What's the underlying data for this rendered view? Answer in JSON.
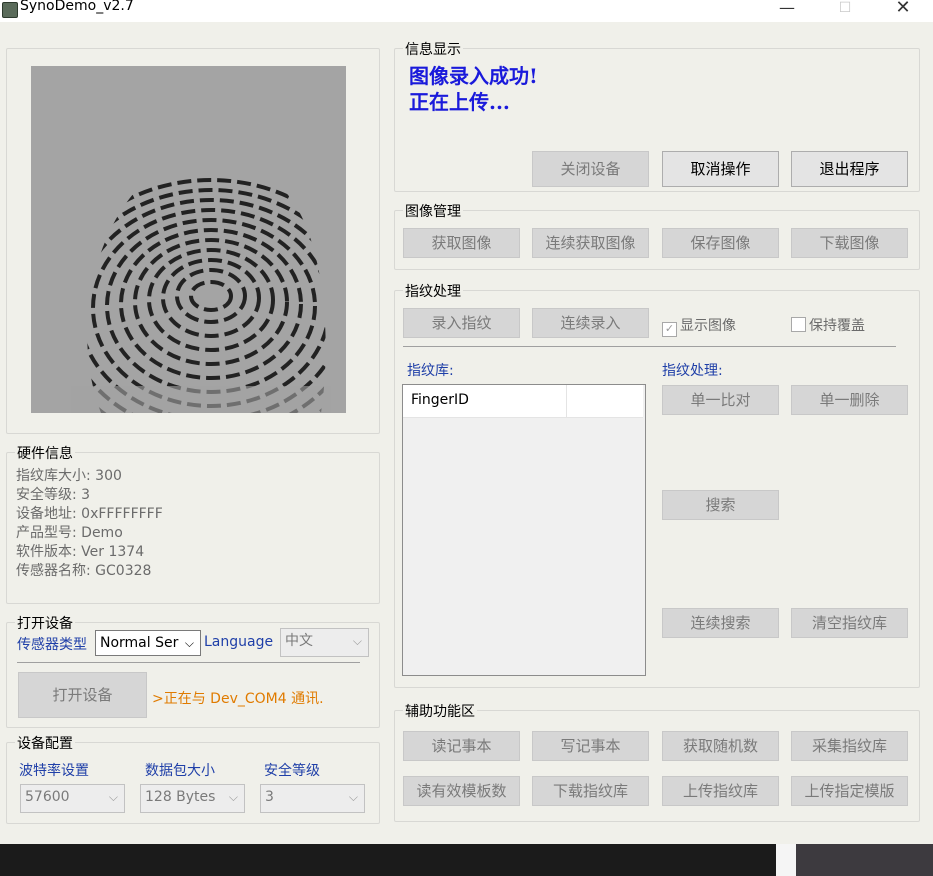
{
  "window": {
    "title": "SynoDemo_v2.7",
    "minimize": "—",
    "maximize": "☐",
    "close": "✕"
  },
  "info_display": {
    "group_label": "信息显示",
    "line1": "图像录入成功!",
    "line2": "正在上传...",
    "buttons": {
      "close_device": "关闭设备",
      "cancel_op": "取消操作",
      "exit_program": "退出程序"
    }
  },
  "image_mgmt": {
    "group_label": "图像管理",
    "buttons": {
      "get_image": "获取图像",
      "continuous_get_image": "连续获取图像",
      "save_image": "保存图像",
      "download_image": "下载图像"
    }
  },
  "fp_processing": {
    "group_label": "指纹处理",
    "buttons": {
      "enroll": "录入指纹",
      "continuous_enroll": "连续录入"
    },
    "show_image": {
      "label": "显示图像",
      "checked": true
    },
    "keep_overwrite": {
      "label": "保持覆盖",
      "checked": false
    },
    "library_label": "指纹库:",
    "library_column": "FingerID",
    "processing_label": "指纹处理:",
    "ops": {
      "match": "单一比对",
      "delete": "单一删除",
      "search": "搜索",
      "continuous_search": "连续搜索",
      "clear_lib": "清空指纹库"
    }
  },
  "hardware": {
    "group_label": "硬件信息",
    "lines": [
      "指纹库大小: 300",
      "安全等级: 3",
      "设备地址: 0xFFFFFFFF",
      "产品型号:  Demo",
      "软件版本: Ver 1374",
      "传感器名称: GC0328"
    ]
  },
  "open_device": {
    "group_label": "打开设备",
    "sensor_type_label": "传感器类型",
    "sensor_type_value": "Normal Ser",
    "language_label": "Language",
    "language_value": "中文",
    "open_button": "打开设备",
    "status": ">正在与 Dev_COM4 通讯."
  },
  "device_config": {
    "group_label": "设备配置",
    "baud_label": "波特率设置",
    "baud_value": "57600",
    "packet_label": "数据包大小",
    "packet_value": "128 Bytes",
    "security_label": "安全等级",
    "security_value": "3"
  },
  "aux": {
    "group_label": "辅助功能区",
    "buttons": {
      "read_notepad": "读记事本",
      "write_notepad": "写记事本",
      "get_random": "获取随机数",
      "collect_lib": "采集指纹库",
      "read_valid_count": "读有效模板数",
      "download_lib": "下载指纹库",
      "upload_lib": "上传指纹库",
      "upload_template": "上传指定模版"
    }
  },
  "icons": {
    "app": "app-icon",
    "dropdown": "chevron-down-icon",
    "check": "checkmark-icon"
  },
  "colors": {
    "info_text": "#1a1adb",
    "label_blue": "#1f3fa8",
    "status_orange": "#e07b00",
    "disabled_text": "#7a7a7a"
  }
}
